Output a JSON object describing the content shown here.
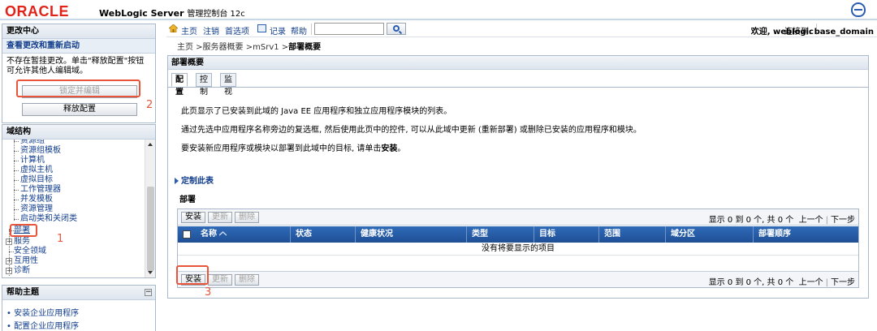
{
  "banner": {
    "brand": "ORACLE",
    "product": "WebLogic Server",
    "product_sub": "管理控制台 12c"
  },
  "change_center": {
    "title": "更改中心",
    "view_link": "查看更改和重新启动",
    "message": "不存在暂挂更改。单击\"释放配置\"按钮可允许其他人编辑域。",
    "lock_button": "锁定并编辑",
    "release_button": "释放配置"
  },
  "domain_structure": {
    "title": "域结构",
    "items": [
      "资源组",
      "资源组模板",
      "计算机",
      "虚拟主机",
      "虚拟目标",
      "工作管理器",
      "并发模板",
      "资源管理",
      "启动类和关闭类",
      "部署",
      "服务",
      "安全领域",
      "互用性",
      "诊断"
    ]
  },
  "help": {
    "title": "帮助主题",
    "items": [
      "安装企业应用程序",
      "配置企业应用程序"
    ]
  },
  "toolbar": {
    "home": "主页",
    "logout": "注销",
    "preferences": "首选项",
    "record": "记录",
    "help": "帮助",
    "welcome": "欢迎, weblogic",
    "connected_label": "连接到:",
    "domain": "base_domain"
  },
  "breadcrumb": {
    "path": "主页 >服务器概要 >mSrv1 >",
    "current": "部署概要"
  },
  "main": {
    "title": "部署概要",
    "tabs": [
      "配置",
      "控制",
      "监视"
    ],
    "para1": "此页显示了已安装到此域的 Java EE 应用程序和独立应用程序模块的列表。",
    "para2": "通过先选中应用程序名称旁边的复选框, 然后使用此页中的控件, 可以从此域中更新 (重新部署) 或删除已安装的应用程序和模块。",
    "para3_a": "要安装新应用程序或模块以部署到此域中的目标, 请单击",
    "para3_b": "安装",
    "para3_c": "。",
    "customize": "定制此表",
    "section": "部署",
    "buttons": {
      "install": "安装",
      "update": "更新",
      "delete": "删除"
    },
    "pager": {
      "range": "显示 0 到 0 个, 共 0 个",
      "prev": "上一个",
      "next": "下一步"
    },
    "columns": [
      "名称",
      "状态",
      "健康状况",
      "类型",
      "目标",
      "范围",
      "域分区",
      "部署顺序"
    ],
    "empty": "没有将要显示的项目"
  },
  "annotations": {
    "n1": "1",
    "n2": "2",
    "n3": "3"
  },
  "colors": {
    "accent": "#123e8c",
    "header_blue": "#2f6bb9",
    "highlight": "#e8553a",
    "oracle_red": "#e2231a"
  }
}
